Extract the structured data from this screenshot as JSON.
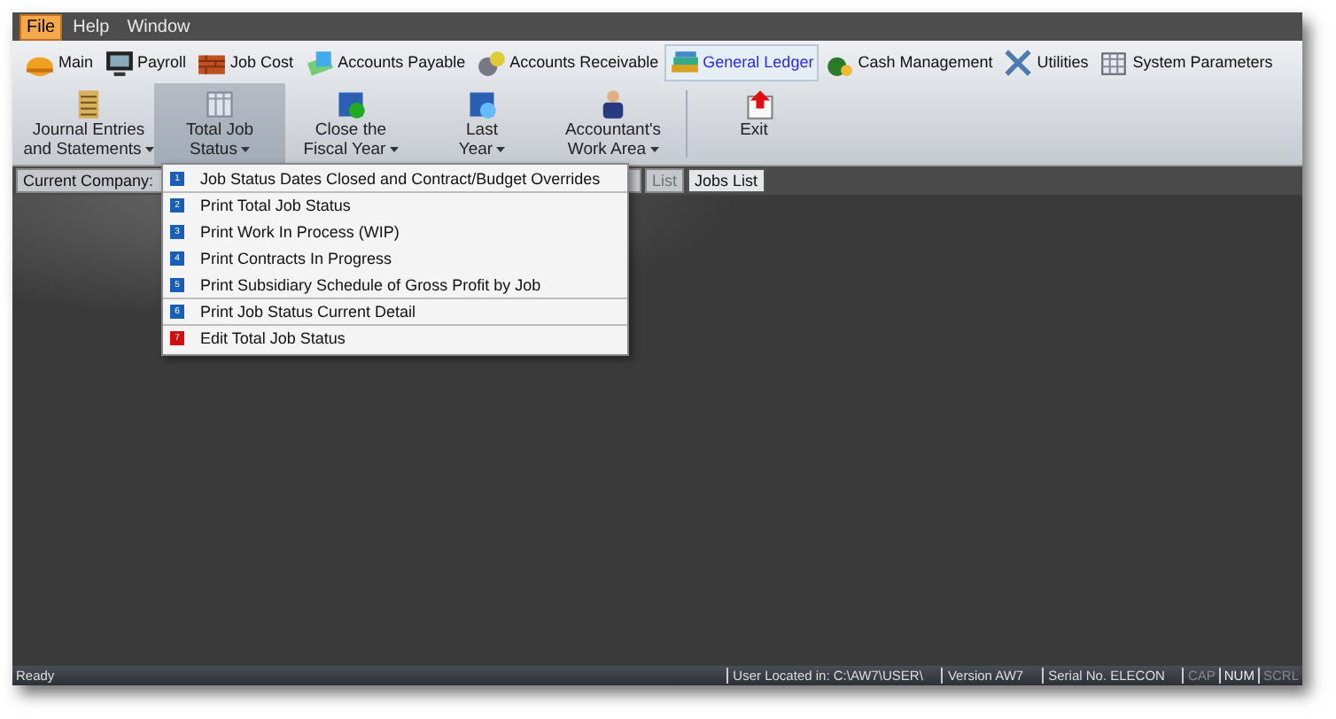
{
  "menu_bar": [
    {
      "label": "File",
      "selected": true
    },
    {
      "label": "Help",
      "selected": false
    },
    {
      "label": "Window",
      "selected": false
    }
  ],
  "modules": [
    {
      "label": "Main",
      "selected": false
    },
    {
      "label": "Payroll",
      "selected": false
    },
    {
      "label": "Job Cost",
      "selected": false
    },
    {
      "label": "Accounts Payable",
      "selected": false
    },
    {
      "label": "Accounts Receivable",
      "selected": false
    },
    {
      "label": "General Ledger",
      "selected": true
    },
    {
      "label": "Cash Management",
      "selected": false
    },
    {
      "label": "Utilities",
      "selected": false
    },
    {
      "label": "System Parameters",
      "selected": false
    }
  ],
  "ribbon": [
    {
      "lines": [
        "Journal Entries",
        "and Statements"
      ],
      "dropdown": true,
      "selected": false
    },
    {
      "lines": [
        "Total Job",
        "Status"
      ],
      "dropdown": true,
      "selected": true
    },
    {
      "lines": [
        "Close the",
        "Fiscal Year"
      ],
      "dropdown": true,
      "selected": false
    },
    {
      "lines": [
        "Last",
        "Year"
      ],
      "dropdown": true,
      "selected": false
    },
    {
      "lines": [
        "Accountant's",
        "Work Area"
      ],
      "dropdown": true,
      "selected": false
    },
    {
      "lines": [
        "Exit"
      ],
      "dropdown": false,
      "selected": false
    }
  ],
  "doc_tabs": [
    {
      "label": "Current Company:",
      "selected": false,
      "dim": false
    },
    {
      "label": "List",
      "selected": false,
      "dim": true
    },
    {
      "label": "Jobs List",
      "selected": true,
      "dim": false
    }
  ],
  "dropdown_menu": [
    {
      "number": "1",
      "label": "Job Status Dates Closed and Contract/Budget Overrides",
      "color": "#1a5fb4",
      "separator_after": true
    },
    {
      "number": "2",
      "label": "Print Total Job Status",
      "color": "#1a5fb4",
      "separator_after": false
    },
    {
      "number": "3",
      "label": "Print Work In Process (WIP)",
      "color": "#1a5fb4",
      "separator_after": false
    },
    {
      "number": "4",
      "label": "Print Contracts In Progress",
      "color": "#1a5fb4",
      "separator_after": false
    },
    {
      "number": "5",
      "label": "Print Subsidiary Schedule of Gross Profit by Job",
      "color": "#1a5fb4",
      "separator_after": true
    },
    {
      "number": "6",
      "label": "Print Job Status Current Detail",
      "color": "#1a5fb4",
      "separator_after": true
    },
    {
      "number": "7",
      "label": "Edit Total Job Status",
      "color": "#d01010",
      "separator_after": false
    }
  ],
  "status_bar": {
    "message": "Ready",
    "panels": [
      "User Located in: C:\\AW7\\USER\\",
      "Version AW7",
      "Serial No. ELECON"
    ],
    "indicators": [
      {
        "label": "CAP",
        "on": false
      },
      {
        "label": "NUM",
        "on": true
      },
      {
        "label": "SCRL",
        "on": false
      }
    ]
  }
}
